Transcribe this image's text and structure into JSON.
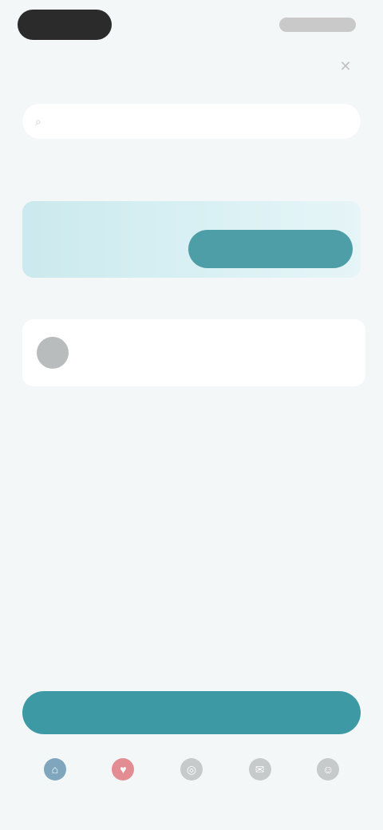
{
  "nav": {
    "title": "",
    "action_icon": "close-icon"
  },
  "search": {
    "placeholder": "",
    "icon": "search-icon"
  },
  "tabs": [
    {
      "label": "",
      "active": true
    },
    {
      "label": "",
      "active": false
    },
    {
      "label": "",
      "active": false
    },
    {
      "label": "",
      "active": false
    },
    {
      "label": "",
      "active": false
    }
  ],
  "promo": {
    "text": "",
    "button_label": ""
  },
  "list": {
    "items": [
      {
        "title": "",
        "subtitle": "",
        "icon": "avatar"
      }
    ]
  },
  "more_label": "",
  "primary_button_label": "",
  "bottom_nav": [
    {
      "label": "",
      "icon": "home-icon",
      "active": true
    },
    {
      "label": "",
      "icon": "heart-icon",
      "active": false
    },
    {
      "label": "",
      "icon": "compass-icon",
      "active": false
    },
    {
      "label": "",
      "icon": "chat-icon",
      "active": false
    },
    {
      "label": "",
      "icon": "user-icon",
      "active": false
    }
  ],
  "colors": {
    "background": "#f3f7f8",
    "accent": "#3d9aa5",
    "promo_gradient_start": "#cbe9ee",
    "alert": "#e38d93"
  }
}
